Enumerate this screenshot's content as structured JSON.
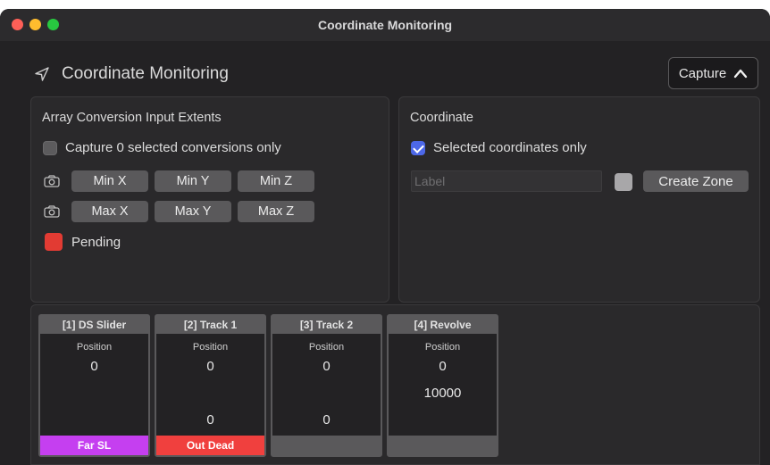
{
  "window": {
    "title": "Coordinate Monitoring"
  },
  "header": {
    "title": "Coordinate Monitoring",
    "capture_label": "Capture"
  },
  "extents": {
    "title": "Array Conversion Input Extents",
    "capture_selected_label": "Capture 0 selected conversions only",
    "capture_selected_checked": false,
    "min_buttons": [
      "Min X",
      "Min Y",
      "Min Z"
    ],
    "max_buttons": [
      "Max X",
      "Max Y",
      "Max Z"
    ],
    "status_label": "Pending",
    "status_color": "#e23b33"
  },
  "coordinate": {
    "title": "Coordinate",
    "selected_only_label": "Selected coordinates only",
    "selected_only_checked": true,
    "label_placeholder": "Label",
    "label_value": "",
    "swatch_color": "#a8a7a9",
    "create_zone_label": "Create Zone"
  },
  "tracks": [
    {
      "name": "[1] DS Slider",
      "position_label": "Position",
      "value_top": "0",
      "value_mid": "",
      "value_bottom": "",
      "status": "Far SL",
      "status_color": "#c53ff0"
    },
    {
      "name": "[2] Track 1",
      "position_label": "Position",
      "value_top": "0",
      "value_mid": "",
      "value_bottom": "0",
      "status": "Out Dead",
      "status_color": "#f0403e"
    },
    {
      "name": "[3] Track 2",
      "position_label": "Position",
      "value_top": "0",
      "value_mid": "",
      "value_bottom": "0",
      "status": "",
      "status_color": "#5a595b"
    },
    {
      "name": "[4] Revolve",
      "position_label": "Position",
      "value_top": "0",
      "value_mid": "10000",
      "value_bottom": "",
      "status": "",
      "status_color": "#5a595b"
    }
  ]
}
